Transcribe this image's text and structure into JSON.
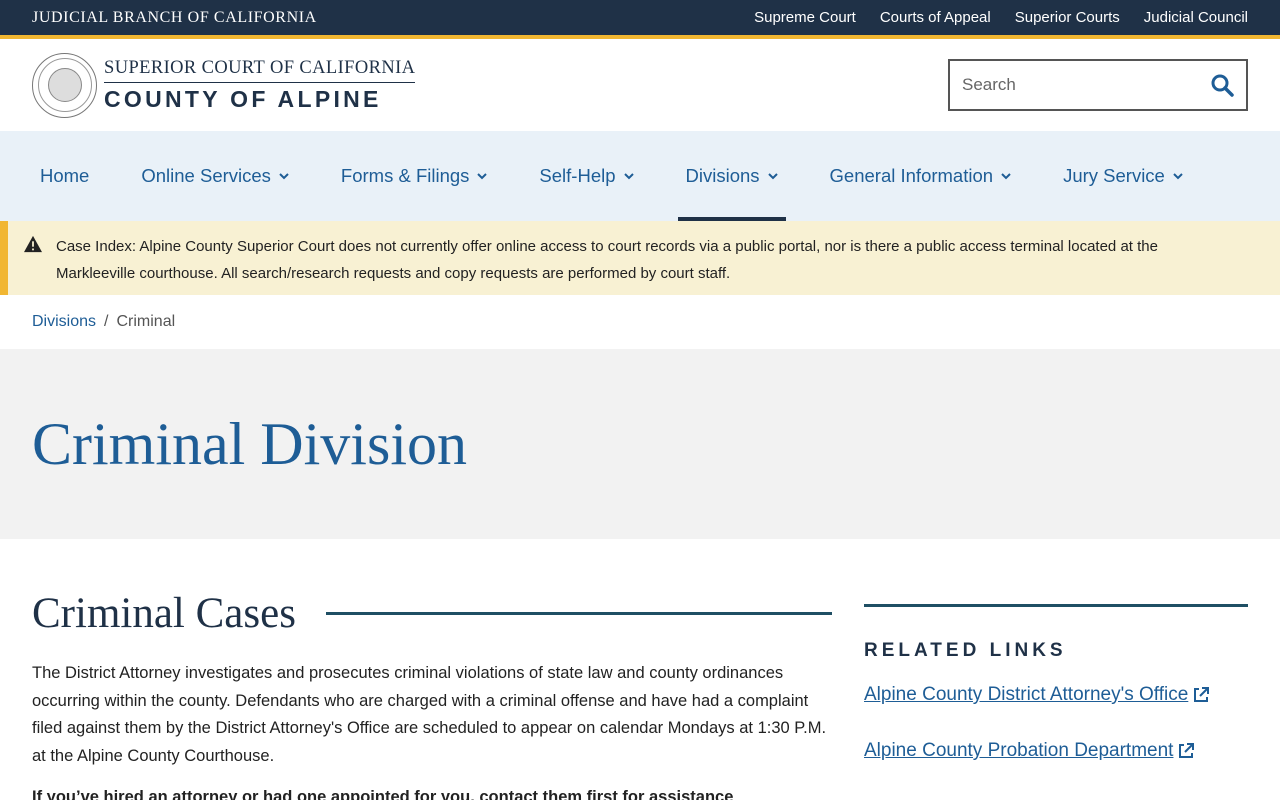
{
  "utility": {
    "brand": "JUDICIAL BRANCH OF CALIFORNIA",
    "links": [
      "Supreme Court",
      "Courts of Appeal",
      "Superior Courts",
      "Judicial Council"
    ]
  },
  "header": {
    "logo_top": "SUPERIOR COURT OF CALIFORNIA",
    "logo_bottom": "COUNTY OF ALPINE",
    "search_placeholder": "Search"
  },
  "nav": {
    "items": [
      "Home",
      "Online Services",
      "Forms & Filings",
      "Self-Help",
      "Divisions",
      "General Information",
      "Jury Service"
    ],
    "active": "Divisions"
  },
  "alert": {
    "label": "Case Index:",
    "text": " Alpine County Superior Court does not currently offer online access to court records via a public portal, nor is there a public access terminal located at the Markleeville courthouse. All search/research requests and copy requests are performed by court staff."
  },
  "breadcrumb": {
    "parent": "Divisions",
    "separator": "/",
    "current": "Criminal"
  },
  "hero": {
    "title": "Criminal Division"
  },
  "main": {
    "heading": "Criminal Cases",
    "paragraph": "The District Attorney investigates and prosecutes criminal violations of state law and county ordinances occurring within the county. Defendants who are charged with a criminal offense and have had a complaint filed against them by the District Attorney's Office are scheduled to appear on calendar Mondays at 1:30 P.M. at the Alpine County Courthouse.",
    "bold_line": "If you’ve hired an attorney or had one appointed for you, contact them first for assistance"
  },
  "aside": {
    "heading": "RELATED LINKS",
    "links": [
      "Alpine County District Attorney's Office",
      "Alpine County Probation Department"
    ]
  },
  "colors": {
    "utility_bar": "#1f3147",
    "accent_gold": "#f1b631",
    "link_blue": "#1e5d96",
    "nav_bg": "#e9f1f8",
    "alert_bg": "#f8f1d3",
    "hero_bg": "#f2f2f2"
  }
}
